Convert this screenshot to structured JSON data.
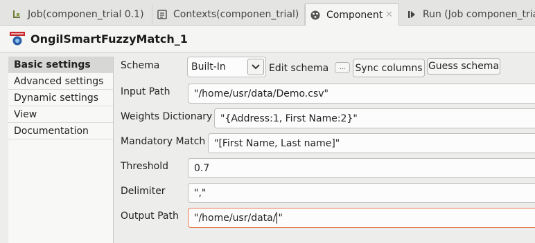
{
  "tabs": [
    {
      "label": "Job(componen_trial 0.1)",
      "icon": "job-icon"
    },
    {
      "label": "Contexts(componen_trial)",
      "icon": "contexts-icon"
    },
    {
      "label": "Component",
      "icon": "component-icon",
      "active": true,
      "close": "✕"
    },
    {
      "label": "Run (Job componen_trial)",
      "icon": "run-icon"
    }
  ],
  "component": {
    "title": "OngilSmartFuzzyMatch_1",
    "icon": "ongil-logo-icon"
  },
  "nav": {
    "items": [
      "Basic settings",
      "Advanced settings",
      "Dynamic settings",
      "View",
      "Documentation"
    ],
    "active_index": 0
  },
  "form": {
    "schema": {
      "label": "Schema",
      "value": "Built-In",
      "edit_label": "Edit schema",
      "ellipsis": "...",
      "sync_label": "Sync columns",
      "guess_label": "Guess schema"
    },
    "input_path": {
      "label": "Input Path",
      "value": "\"/home/usr/data/Demo.csv\""
    },
    "weights": {
      "label": "Weights Dictionary",
      "value": "\"{Address:1, First Name:2}\""
    },
    "mandatory": {
      "label": "Mandatory Match",
      "value": "\"[First Name, Last name]\""
    },
    "threshold": {
      "label": "Threshold",
      "value": "0.7"
    },
    "delimiter": {
      "label": "Delimiter",
      "value": "\",\""
    },
    "output_path": {
      "label": "Output Path",
      "value_before": "\"/home/usr/data/",
      "value_after": "\""
    }
  },
  "colors": {
    "focus_border": "#e8774a",
    "active_nav_bg": "#d7d7d5"
  }
}
